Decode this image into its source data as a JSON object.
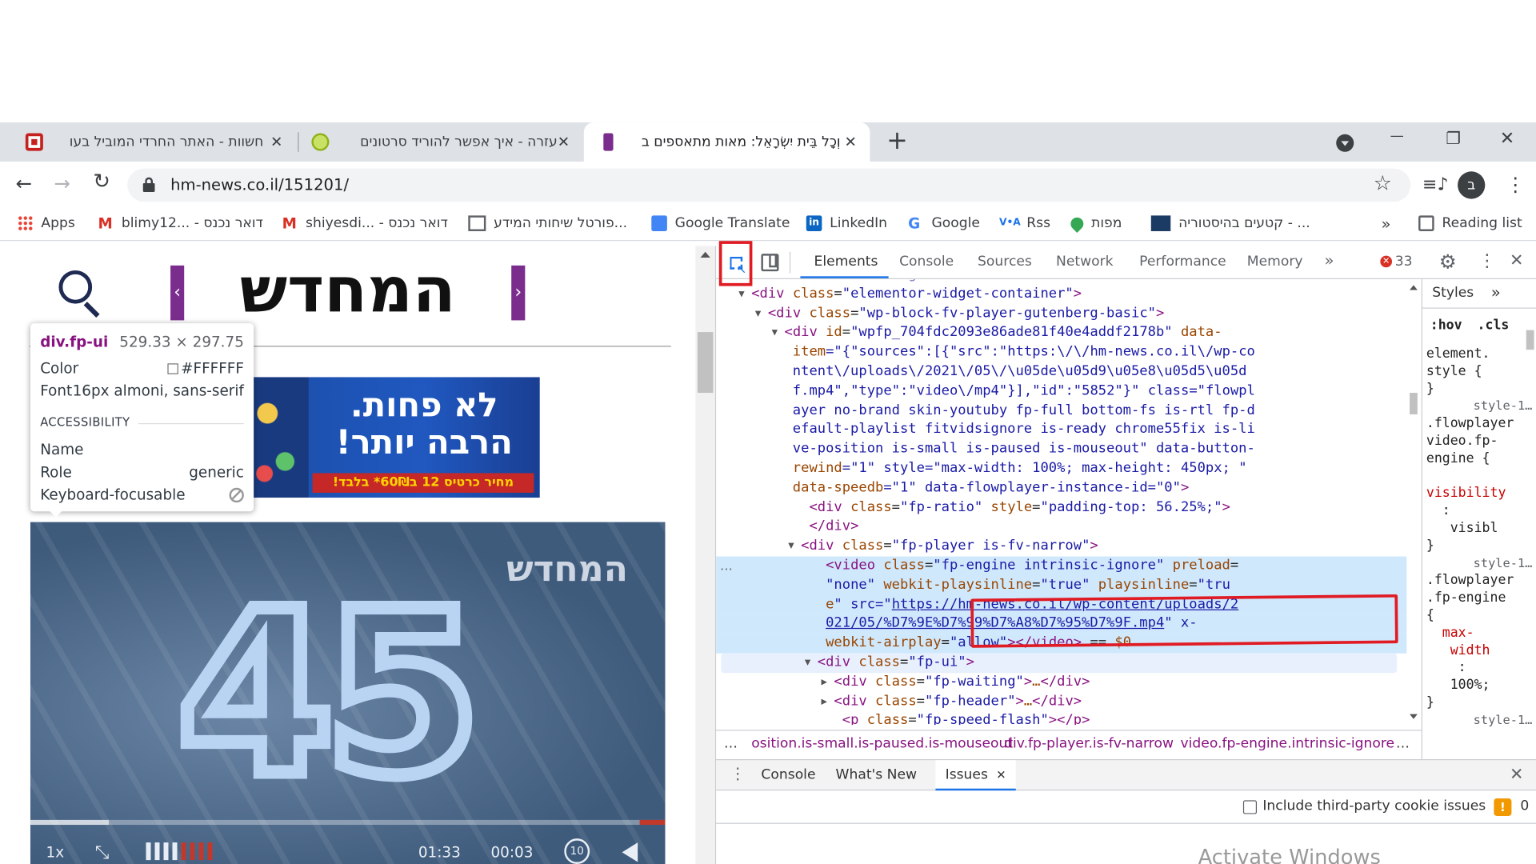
{
  "tabs": [
    {
      "title": "חשוות - האתר החרדי המוביל בעו",
      "close": "✕"
    },
    {
      "title": "עזרה - איך אפשר להוריד סרטונים",
      "close": "✕"
    },
    {
      "title": "וְכָל בֵּית יִשְׂרָאֵל: מאות מתאספים ב",
      "close": "✕"
    }
  ],
  "new_tab": "+",
  "window_controls": {
    "minimize": "—",
    "restore": "❐",
    "close": "✕"
  },
  "url": "hm-news.co.il/151201/",
  "profile_initial": "ב",
  "bookmarks": [
    {
      "label": "Apps",
      "icon": "apps-grid-icon",
      "color": "#e94235"
    },
    {
      "label": "blimy12... - דואר נכנס",
      "icon": "gmail-icon",
      "color": "#d93025"
    },
    {
      "label": "shiyesdi... - דואר נכנס",
      "icon": "gmail-icon",
      "color": "#d93025"
    },
    {
      "label": "פורטל שיחותי המידע...",
      "icon": "portal-icon",
      "color": "#5f6368"
    },
    {
      "label": "Google Translate",
      "icon": "translate-icon",
      "color": "#4285f4"
    },
    {
      "label": "LinkedIn",
      "icon": "linkedin-icon",
      "color": "#0a66c2"
    },
    {
      "label": "Google",
      "icon": "google-icon",
      "color": "#4285f4"
    },
    {
      "label": "Rss",
      "icon": "rss-icon",
      "color": "#1a73e8"
    },
    {
      "label": "מפות",
      "icon": "maps-pin-icon",
      "color": "#34a853"
    },
    {
      "label": "קטעים בהיסטוריה - ...",
      "icon": "history-icon",
      "color": "#1c3b64"
    }
  ],
  "bookmarks_more": "»",
  "reading_list": "Reading list",
  "site": {
    "logo_text": "המחדש",
    "ad_line1": "לא פחות.",
    "ad_line2": "הרבה יותר!",
    "ad_price": "מחיר כרטיס 12 ב60₪* בלבד!",
    "video_watermark": "המחדש",
    "video_number": "45",
    "speed": "1x",
    "time_total": "01:33",
    "time_current": "00:03",
    "skip": "10"
  },
  "tooltip": {
    "selector": "div.fp-ui",
    "size": "529.33 × 297.75",
    "color_label": "Color",
    "color_value": "#FFFFFF",
    "font_label": "Font",
    "font_value": "16px almoni, sans-serif",
    "section": "ACCESSIBILITY",
    "name_label": "Name",
    "name_value": "",
    "role_label": "Role",
    "role_value": "generic",
    "focus_label": "Keyboard-focusable",
    "focus_value": "⃠"
  },
  "devtools": {
    "tabs": [
      "Elements",
      "Console",
      "Sources",
      "Network",
      "Performance",
      "Memory"
    ],
    "active_tab": "Elements",
    "more": "»",
    "error_count": "33",
    "code_lines": [
      {
        "indent": 8,
        "arrow": "",
        "text": "<div class=\"elementor-widget-content\">",
        "hl": false,
        "faded": true
      },
      {
        "indent": 14,
        "arrow": "▼",
        "text": "<div class=\"elementor-widget-container\">",
        "hl": false
      },
      {
        "indent": 16,
        "arrow": "▼",
        "text": "<div class=\"wp-block-fv-player-gutenberg-basic\">",
        "hl": false
      },
      {
        "indent": 18,
        "arrow": "▼",
        "text": "<div id=\"wpfp_704fdc2093e86ade81f40e4addf2178b\" data-",
        "hl": false
      },
      {
        "indent": 19,
        "arrow": "",
        "text": "item=\"{\"sources\":[{\"src\":\"https:\\/\\/hm-news.co.il\\/wp-co",
        "hl": false
      },
      {
        "indent": 19,
        "arrow": "",
        "text": "ntent\\/uploads\\/2021\\/05\\/\\u05de\\u05d9\\u05e8\\u05d5\\u05d",
        "hl": false
      },
      {
        "indent": 19,
        "arrow": "",
        "text": "f.mp4\",\"type\":\"video\\/mp4\"}],\"id\":\"5852\"}\" class=\"flowpl",
        "hl": false
      },
      {
        "indent": 19,
        "arrow": "",
        "text": "ayer no-brand skin-youtuby fp-full bottom-fs is-rtl fp-d",
        "hl": false
      },
      {
        "indent": 19,
        "arrow": "",
        "text": "efault-playlist fitvidsignore is-ready chrome55fix is-li",
        "hl": false
      },
      {
        "indent": 19,
        "arrow": "",
        "text": "ve-position is-small is-paused is-mouseout\" data-button-",
        "hl": false
      },
      {
        "indent": 19,
        "arrow": "",
        "text": "rewind=\"1\" style=\"max-width: 100%; max-height: 450px; \"",
        "hl": false
      },
      {
        "indent": 19,
        "arrow": "",
        "text": "data-speedb=\"1\" data-flowplayer-instance-id=\"0\">",
        "hl": false
      },
      {
        "indent": 21,
        "arrow": "",
        "text": "<div class=\"fp-ratio\" style=\"padding-top: 56.25%;\">",
        "hl": false
      },
      {
        "indent": 21,
        "arrow": "",
        "text": "</div>",
        "hl": false
      },
      {
        "indent": 20,
        "arrow": "▼",
        "text": "<div class=\"fp-player is-fv-narrow\">",
        "hl": false
      },
      {
        "indent": 23,
        "arrow": "",
        "text": "<video class=\"fp-engine intrinsic-ignore\" preload=",
        "hl": true
      },
      {
        "indent": 23,
        "arrow": "",
        "text": "\"none\" webkit-playsinline=\"true\" playsinline=\"tru",
        "hl": true
      },
      {
        "indent": 23,
        "arrow": "",
        "text": "e\" src=\"https://hm-news.co.il/wp-content/uploads/2",
        "hl": true
      },
      {
        "indent": 23,
        "arrow": "",
        "text": "021/05/%D7%9E%D7%99%D7%A8%D7%95%D7%9F.mp4\" x-",
        "hl": true
      },
      {
        "indent": 23,
        "arrow": "",
        "text": "webkit-airplay=\"allow\"></video> == $0",
        "hl": true
      },
      {
        "indent": 22,
        "arrow": "▼",
        "text": "<div class=\"fp-ui\">",
        "hl": false,
        "soft": true
      },
      {
        "indent": 24,
        "arrow": "▶",
        "text": "<div class=\"fp-waiting\">…</div>",
        "hl": false
      },
      {
        "indent": 24,
        "arrow": "▶",
        "text": "<div class=\"fp-header\">…</div>",
        "hl": false
      },
      {
        "indent": 25,
        "arrow": "",
        "text": "<p class=\"fp-speed-flash\"></p>",
        "hl": false
      }
    ],
    "video_src_link": "https://hm-news.co.il/wp-content/uploads/2021/05/%D7%9E%D7%99%D7%A8%D7%95%D7%9F.mp4",
    "breadcrumbs": [
      "…",
      "osition.is-small.is-paused.is-mouseout",
      "div.fp-player.is-fv-narrow",
      "video.fp-engine.intrinsic-ignore",
      "…"
    ],
    "styles": {
      "tab": "Styles",
      "more": "»",
      "hov": ":hov",
      "cls": ".cls",
      "lines": [
        {
          "t": "element.",
          "c": "#222"
        },
        {
          "t": "style {",
          "c": "#222"
        },
        {
          "t": "}",
          "c": "#222"
        },
        {
          "t": "style-1…",
          "c": "#5f6368",
          "right": true
        },
        {
          "t": ".flowplayer",
          "c": "#222"
        },
        {
          "t": "video.fp-",
          "c": "#222"
        },
        {
          "t": "engine {",
          "c": "#222"
        },
        {
          "t": "",
          "c": "#222"
        },
        {
          "t": "visibility",
          "c": "#c80000"
        },
        {
          "t": "  :",
          "c": "#222"
        },
        {
          "t": "   visibl",
          "c": "#222"
        },
        {
          "t": "}",
          "c": "#222"
        },
        {
          "t": "style-1…",
          "c": "#5f6368",
          "right": true
        },
        {
          "t": ".flowplayer",
          "c": "#222"
        },
        {
          "t": ".fp-engine",
          "c": "#222"
        },
        {
          "t": "{",
          "c": "#222"
        },
        {
          "t": "  max-",
          "c": "#c80000"
        },
        {
          "t": "   width",
          "c": "#c80000"
        },
        {
          "t": "    :",
          "c": "#222"
        },
        {
          "t": "   100%;",
          "c": "#222"
        },
        {
          "t": "}",
          "c": "#222"
        },
        {
          "t": "style-1…",
          "c": "#5f6368",
          "right": true
        }
      ]
    },
    "drawer": {
      "tabs": [
        "Console",
        "What's New",
        "Issues"
      ],
      "active": "Issues",
      "close": "✕"
    },
    "issues": {
      "checkbox_label": "Include third-party cookie issues",
      "count": "0",
      "activate_text": "Activate Windows"
    }
  }
}
